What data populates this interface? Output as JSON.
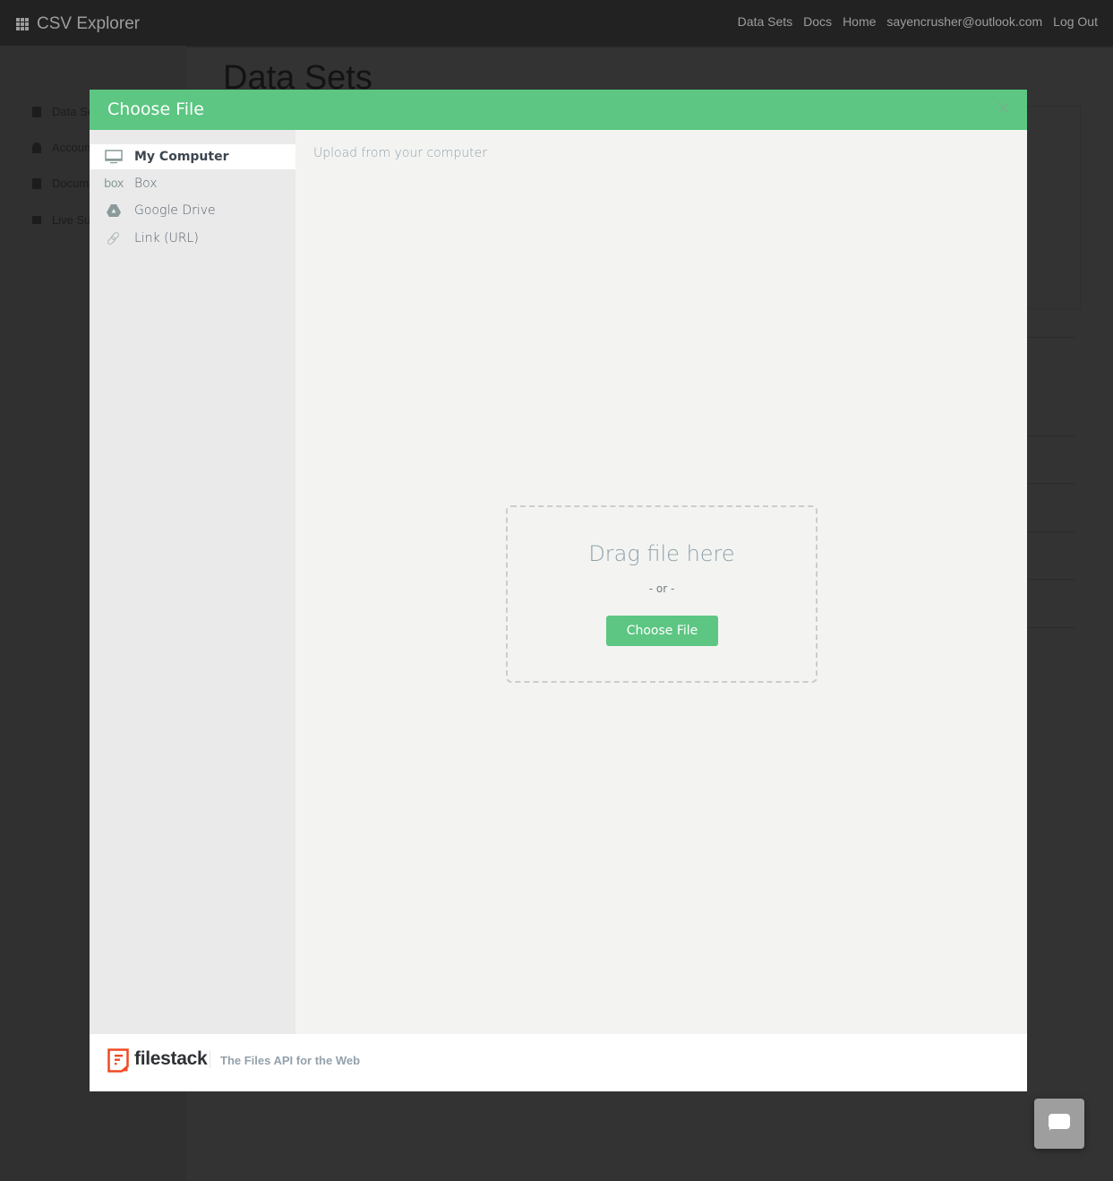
{
  "navbar": {
    "brand": "CSV Explorer",
    "brand_icon": "grid-icon",
    "links": [
      "Data Sets",
      "Docs",
      "Home",
      "sayencrusher@outlook.com",
      "Log Out"
    ]
  },
  "background_page": {
    "title": "Data Sets",
    "sidebar_items": [
      {
        "label": "Data Sets",
        "icon": "file-icon"
      },
      {
        "label": "Account",
        "icon": "user-icon"
      },
      {
        "label": "Documentation",
        "icon": "book-icon"
      },
      {
        "label": "Live Support",
        "icon": "chat-icon"
      }
    ]
  },
  "modal": {
    "title": "Choose File",
    "close_icon": "close-icon",
    "sources": [
      {
        "label": "My Computer",
        "icon": "monitor-icon",
        "active": true
      },
      {
        "label": "Box",
        "icon": "box-icon",
        "icon_text": "box",
        "active": false
      },
      {
        "label": "Google Drive",
        "icon": "google-drive-icon",
        "active": false
      },
      {
        "label": "Link (URL)",
        "icon": "link-icon",
        "active": false
      }
    ],
    "content": {
      "heading": "Upload from your computer",
      "drop_text": "Drag file here",
      "or_text": "- or -",
      "choose_button": "Choose File"
    },
    "footer": {
      "brand": "filestack",
      "tagline": "The Files API for the Web",
      "logo_color": "#ef4a25"
    }
  },
  "colors": {
    "accent": "#5cc682",
    "navbar_bg": "#222222",
    "overlay_bg": "#333333"
  },
  "chat_widget": {
    "icon": "chat-bubble-icon"
  }
}
